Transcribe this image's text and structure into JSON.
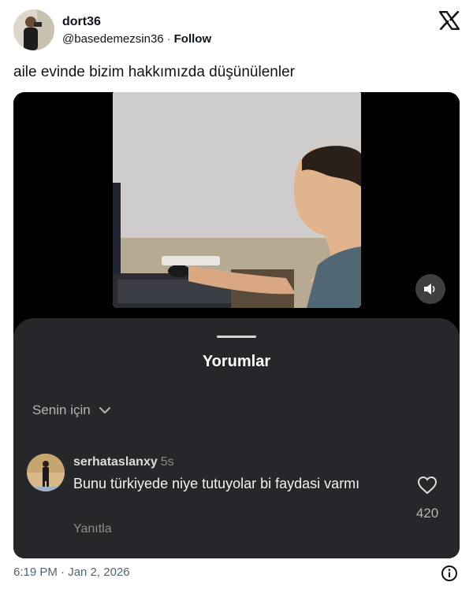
{
  "author": {
    "display_name": "dort36",
    "handle": "@basedemezsin36",
    "separator": "·",
    "follow_label": "Follow",
    "avatar_icon": "profile-photo"
  },
  "platform_icon": "x-logo-icon",
  "tweet": {
    "text": "aile evinde bizim hakkımızda düşünülenler",
    "timestamp": "6:19 PM · Jan 2, 2026"
  },
  "media": {
    "mute_icon": "speaker-icon",
    "comments_sheet": {
      "title": "Yorumlar",
      "filter_label": "Senin için",
      "comment": {
        "username": "serhataslanxy",
        "time": "5s",
        "text": "Bunu türkiyede niye tutuyolar bi faydasi varmı",
        "reply_label": "Yanıtla",
        "like_count": "420"
      }
    }
  },
  "colors": {
    "sheet_bg": "#26272b",
    "media_bg": "#000000",
    "text_primary": "#0f1419",
    "text_secondary": "#536471"
  }
}
